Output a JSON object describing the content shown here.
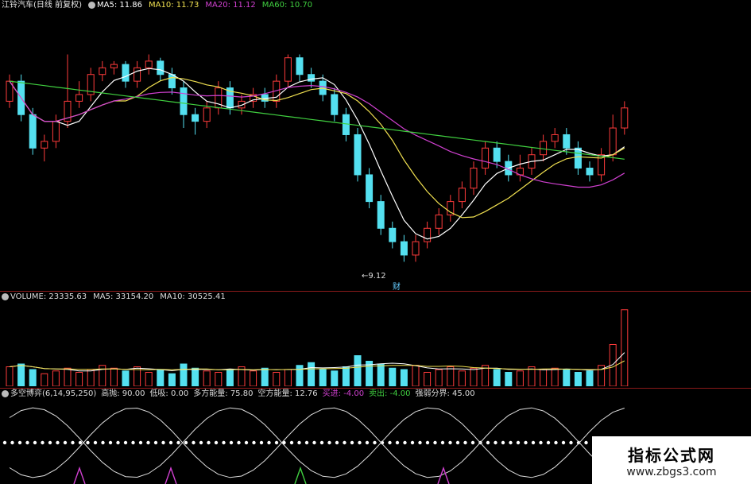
{
  "price_panel": {
    "title": "江铃汽车(日线 前复权)",
    "ma5": "MA5: 11.86",
    "ma10": "MA10: 11.73",
    "ma20": "MA20: 11.12",
    "ma60": "MA60: 10.70",
    "low_marker": "9.12",
    "cai_label": "财",
    "colors": {
      "ma5": "#ffffff",
      "ma10": "#f0e050",
      "ma20": "#d040d0",
      "ma60": "#40d040",
      "up": "#ff3b3b",
      "down": "#54e0f0"
    }
  },
  "volume_panel": {
    "volume": "VOLUME: 23335.63",
    "ma5": "MA5: 33154.20",
    "ma10": "MA10: 30525.41"
  },
  "indicator_panel": {
    "name": "多空博弈(6,14,95,250)",
    "high": "高抛: 90.00",
    "low": "低吸: 0.00",
    "bull": "多方能量: 75.80",
    "bear": "空方能量: 12.76",
    "buy": "买进: -4.00",
    "sell": "卖出: -4.00",
    "divide": "强弱分界: 45.00"
  },
  "watermark": {
    "title": "指标公式网",
    "url": "www.zbgs3.com"
  },
  "chart_data": {
    "type": "candlestick",
    "candles": [
      {
        "o": 11.6,
        "c": 11.9,
        "h": 12.0,
        "l": 11.5
      },
      {
        "o": 11.9,
        "c": 11.4,
        "h": 12.0,
        "l": 11.3
      },
      {
        "o": 11.4,
        "c": 10.9,
        "h": 11.5,
        "l": 10.8
      },
      {
        "o": 10.9,
        "c": 11.0,
        "h": 11.1,
        "l": 10.7
      },
      {
        "o": 11.0,
        "c": 11.3,
        "h": 11.4,
        "l": 10.9
      },
      {
        "o": 11.3,
        "c": 11.6,
        "h": 12.3,
        "l": 11.2
      },
      {
        "o": 11.6,
        "c": 11.7,
        "h": 11.9,
        "l": 11.5
      },
      {
        "o": 11.7,
        "c": 12.0,
        "h": 12.1,
        "l": 11.6
      },
      {
        "o": 12.0,
        "c": 12.1,
        "h": 12.2,
        "l": 11.9
      },
      {
        "o": 12.1,
        "c": 12.15,
        "h": 12.2,
        "l": 12.0
      },
      {
        "o": 12.15,
        "c": 11.9,
        "h": 12.2,
        "l": 11.8
      },
      {
        "o": 11.9,
        "c": 12.1,
        "h": 12.2,
        "l": 11.8
      },
      {
        "o": 12.1,
        "c": 12.2,
        "h": 12.3,
        "l": 12.0
      },
      {
        "o": 12.2,
        "c": 12.0,
        "h": 12.25,
        "l": 11.9
      },
      {
        "o": 12.0,
        "c": 11.8,
        "h": 12.1,
        "l": 11.7
      },
      {
        "o": 11.8,
        "c": 11.4,
        "h": 11.9,
        "l": 11.2
      },
      {
        "o": 11.4,
        "c": 11.3,
        "h": 11.5,
        "l": 11.1
      },
      {
        "o": 11.3,
        "c": 11.5,
        "h": 11.6,
        "l": 11.2
      },
      {
        "o": 11.5,
        "c": 11.8,
        "h": 11.9,
        "l": 11.4
      },
      {
        "o": 11.8,
        "c": 11.5,
        "h": 11.9,
        "l": 11.4
      },
      {
        "o": 11.5,
        "c": 11.6,
        "h": 11.7,
        "l": 11.4
      },
      {
        "o": 11.6,
        "c": 11.7,
        "h": 11.8,
        "l": 11.5
      },
      {
        "o": 11.7,
        "c": 11.6,
        "h": 11.8,
        "l": 11.5
      },
      {
        "o": 11.6,
        "c": 11.9,
        "h": 12.0,
        "l": 11.5
      },
      {
        "o": 11.9,
        "c": 12.25,
        "h": 12.3,
        "l": 11.8
      },
      {
        "o": 12.25,
        "c": 12.0,
        "h": 12.3,
        "l": 11.9
      },
      {
        "o": 12.0,
        "c": 11.9,
        "h": 12.1,
        "l": 11.8
      },
      {
        "o": 11.9,
        "c": 11.7,
        "h": 12.0,
        "l": 11.6
      },
      {
        "o": 11.7,
        "c": 11.4,
        "h": 11.8,
        "l": 11.3
      },
      {
        "o": 11.4,
        "c": 11.1,
        "h": 11.5,
        "l": 11.0
      },
      {
        "o": 11.1,
        "c": 10.5,
        "h": 11.2,
        "l": 10.4
      },
      {
        "o": 10.5,
        "c": 10.1,
        "h": 10.6,
        "l": 10.0
      },
      {
        "o": 10.1,
        "c": 9.7,
        "h": 10.2,
        "l": 9.6
      },
      {
        "o": 9.7,
        "c": 9.5,
        "h": 9.8,
        "l": 9.4
      },
      {
        "o": 9.5,
        "c": 9.3,
        "h": 9.6,
        "l": 9.2
      },
      {
        "o": 9.3,
        "c": 9.5,
        "h": 9.6,
        "l": 9.2
      },
      {
        "o": 9.5,
        "c": 9.7,
        "h": 9.8,
        "l": 9.4
      },
      {
        "o": 9.7,
        "c": 9.9,
        "h": 10.0,
        "l": 9.6
      },
      {
        "o": 9.9,
        "c": 10.1,
        "h": 10.2,
        "l": 9.8
      },
      {
        "o": 10.1,
        "c": 10.3,
        "h": 10.4,
        "l": 10.0
      },
      {
        "o": 10.3,
        "c": 10.6,
        "h": 10.7,
        "l": 10.2
      },
      {
        "o": 10.6,
        "c": 10.9,
        "h": 11.0,
        "l": 10.5
      },
      {
        "o": 10.9,
        "c": 10.7,
        "h": 11.0,
        "l": 10.6
      },
      {
        "o": 10.7,
        "c": 10.5,
        "h": 10.8,
        "l": 10.4
      },
      {
        "o": 10.5,
        "c": 10.6,
        "h": 10.8,
        "l": 10.4
      },
      {
        "o": 10.6,
        "c": 10.8,
        "h": 10.9,
        "l": 10.5
      },
      {
        "o": 10.8,
        "c": 11.0,
        "h": 11.1,
        "l": 10.7
      },
      {
        "o": 11.0,
        "c": 11.1,
        "h": 11.2,
        "l": 10.9
      },
      {
        "o": 11.1,
        "c": 10.9,
        "h": 11.2,
        "l": 10.8
      },
      {
        "o": 10.9,
        "c": 10.6,
        "h": 11.0,
        "l": 10.5
      },
      {
        "o": 10.6,
        "c": 10.5,
        "h": 10.7,
        "l": 10.4
      },
      {
        "o": 10.5,
        "c": 10.8,
        "h": 10.9,
        "l": 10.4
      },
      {
        "o": 10.8,
        "c": 11.2,
        "h": 11.4,
        "l": 10.7
      },
      {
        "o": 11.2,
        "c": 11.5,
        "h": 11.6,
        "l": 11.1
      }
    ],
    "volume": [
      14,
      16,
      12,
      9,
      11,
      13,
      10,
      12,
      15,
      13,
      11,
      14,
      10,
      12,
      9,
      16,
      13,
      11,
      10,
      12,
      14,
      11,
      13,
      10,
      12,
      15,
      17,
      12,
      11,
      14,
      22,
      18,
      16,
      13,
      12,
      15,
      10,
      12,
      14,
      11,
      13,
      15,
      12,
      10,
      11,
      14,
      12,
      13,
      12,
      10,
      11,
      15,
      30,
      55
    ],
    "indicator_center": 45.0,
    "indicator_ylim": [
      0,
      90
    ]
  }
}
